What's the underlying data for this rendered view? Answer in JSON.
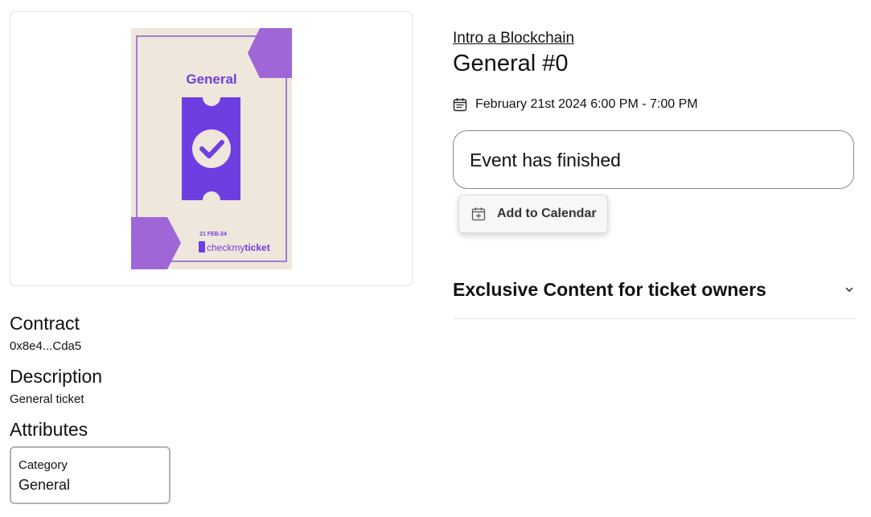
{
  "ticket_image": {
    "art_title": "General",
    "art_date": "21 FEB-24",
    "brand_plain": "checkmy",
    "brand_bold": "ticket",
    "colors": {
      "background": "#efe6dc",
      "accent": "#6f3ee0",
      "hex_shape": "#9f66d6"
    }
  },
  "contract": {
    "title": "Contract",
    "value": "0x8e4...Cda5"
  },
  "description": {
    "title": "Description",
    "value": "General ticket"
  },
  "attributes": {
    "title": "Attributes",
    "items": [
      {
        "trait_type": "Category",
        "value": "General"
      }
    ]
  },
  "event": {
    "link_label": "Intro a Blockchain",
    "ticket_title": "General #0",
    "date_range": "February 21st 2024 6:00 PM - 7:00 PM",
    "date_icon": "calendar-icon"
  },
  "status": {
    "text": "Event has finished"
  },
  "add_to_calendar": {
    "label": "Add to Calendar",
    "icon": "calendar-add-icon"
  },
  "exclusive": {
    "title": "Exclusive Content for ticket owners",
    "icon": "chevron-down-icon"
  }
}
